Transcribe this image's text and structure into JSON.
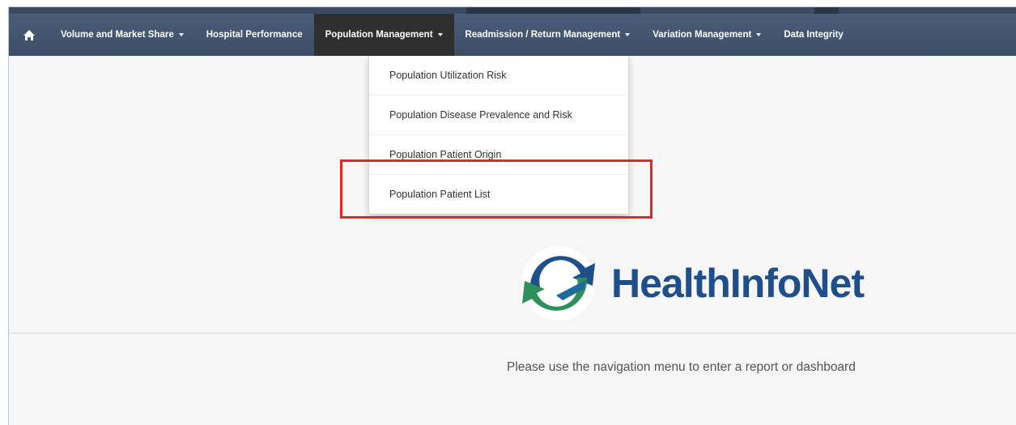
{
  "navbar": {
    "home_icon": "home-icon",
    "items": [
      {
        "label": "Volume and Market Share",
        "has_caret": true
      },
      {
        "label": "Hospital Performance",
        "has_caret": false
      },
      {
        "label": "Population Management",
        "has_caret": true,
        "active": true
      },
      {
        "label": "Readmission / Return Management",
        "has_caret": true
      },
      {
        "label": "Variation Management",
        "has_caret": true
      },
      {
        "label": "Data Integrity",
        "has_caret": false
      }
    ]
  },
  "dropdown": {
    "items": [
      "Population Utilization Risk",
      "Population Disease Prevalence and Risk",
      "Population Patient Origin",
      "Population Patient List"
    ],
    "highlighted_item": "Population Patient List"
  },
  "logo": {
    "text": "HealthInfoNet"
  },
  "main": {
    "hint": "Please use the navigation menu to enter a report or dashboard"
  },
  "colors": {
    "navbar": "#44566f",
    "active_nav": "#2f2f2f",
    "highlight": "#e8261f",
    "logo_blue": "#1d4f8c",
    "logo_green": "#2f8f5b"
  }
}
